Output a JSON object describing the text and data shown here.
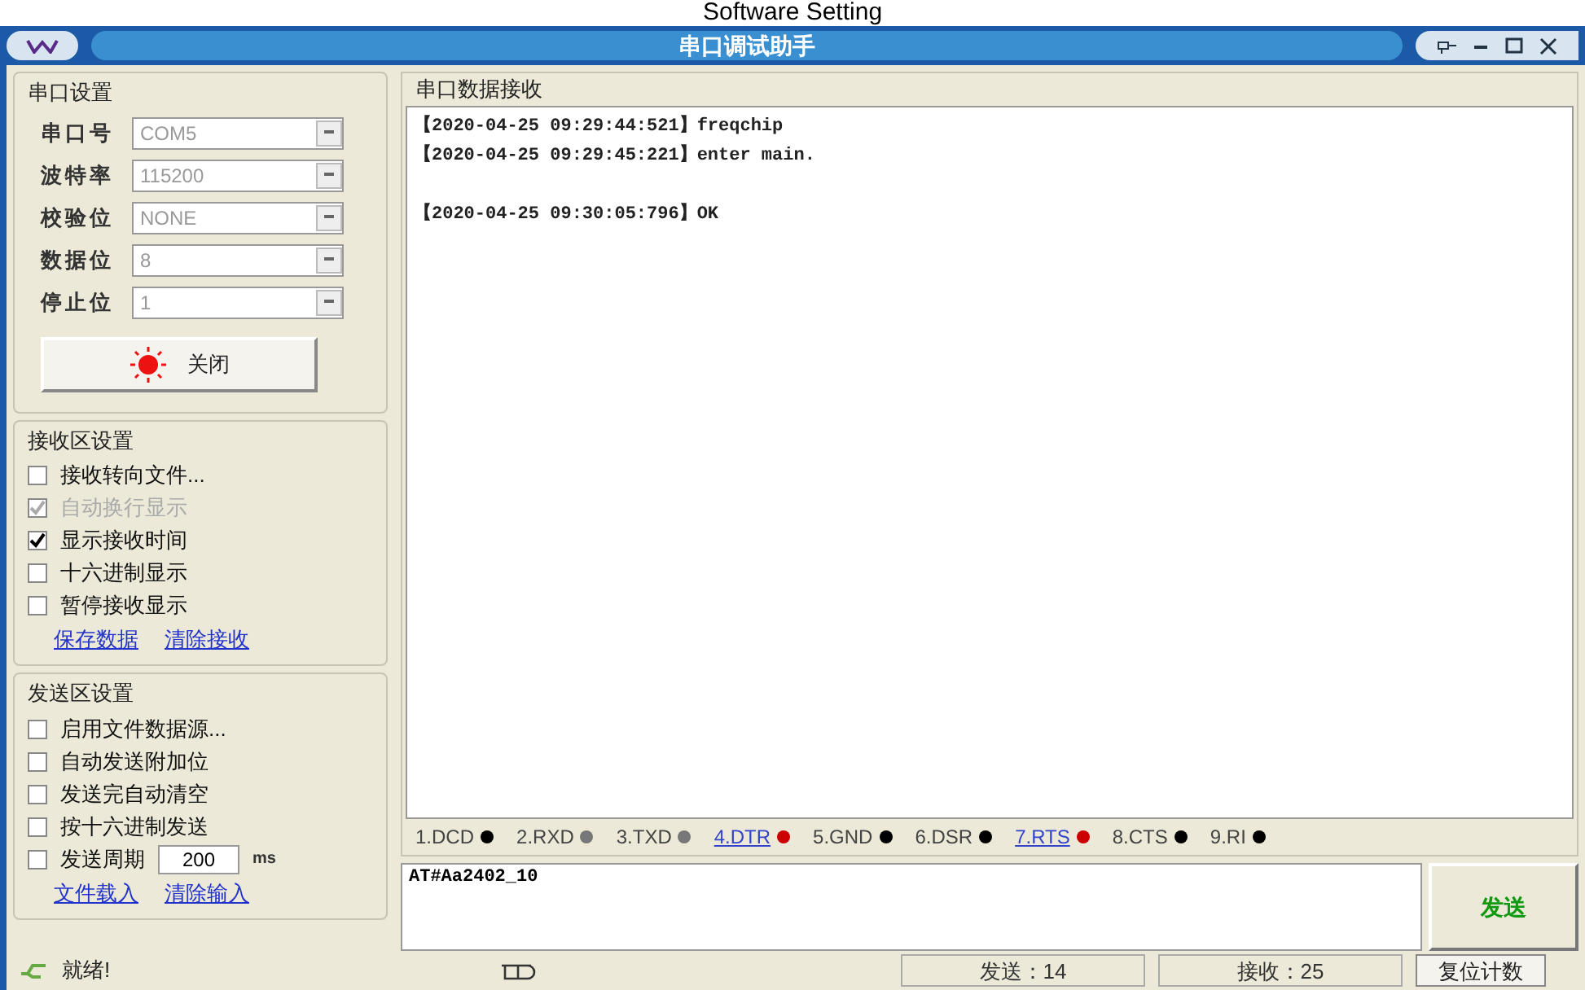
{
  "caption": "Software Setting",
  "window": {
    "title": "串口调试助手"
  },
  "serial_settings": {
    "title": "串口设置",
    "fields": [
      {
        "label": "串口号",
        "value": "COM5"
      },
      {
        "label": "波特率",
        "value": "115200"
      },
      {
        "label": "校验位",
        "value": "NONE"
      },
      {
        "label": "数据位",
        "value": "8"
      },
      {
        "label": "停止位",
        "value": "1"
      }
    ],
    "open_button": {
      "label": "关闭",
      "on": true
    }
  },
  "receive_settings": {
    "title": "接收区设置",
    "options": [
      {
        "label": "接收转向文件...",
        "checked": false
      },
      {
        "label": "自动换行显示",
        "checked": true,
        "disabled": true
      },
      {
        "label": "显示接收时间",
        "checked": true
      },
      {
        "label": "十六进制显示",
        "checked": false
      },
      {
        "label": "暂停接收显示",
        "checked": false
      }
    ],
    "links": [
      "保存数据",
      "清除接收"
    ]
  },
  "send_settings": {
    "title": "发送区设置",
    "options": [
      {
        "label": "启用文件数据源...",
        "checked": false
      },
      {
        "label": "自动发送附加位",
        "checked": false
      },
      {
        "label": "发送完自动清空",
        "checked": false
      },
      {
        "label": "按十六进制发送",
        "checked": false
      }
    ],
    "period": {
      "label": "发送周期",
      "checked": false,
      "value": "200",
      "unit": "ms"
    },
    "links": [
      "文件载入",
      "清除输入"
    ]
  },
  "receive_area": {
    "title": "串口数据接收",
    "blocks": [
      {
        "lines": [
          "【2020-04-25 09:29:44:521】freqchip",
          "【2020-04-25 09:29:45:221】enter main."
        ]
      },
      {
        "lines": [
          "【2020-04-25 09:30:05:796】OK"
        ]
      }
    ]
  },
  "pins": [
    {
      "label": "1.DCD",
      "link": false,
      "color": "#000000"
    },
    {
      "label": "2.RXD",
      "link": false,
      "color": "#777777"
    },
    {
      "label": "3.TXD",
      "link": false,
      "color": "#777777"
    },
    {
      "label": "4.DTR",
      "link": true,
      "color": "#cc0000"
    },
    {
      "label": "5.GND",
      "link": false,
      "color": "#000000"
    },
    {
      "label": "6.DSR",
      "link": false,
      "color": "#000000"
    },
    {
      "label": "7.RTS",
      "link": true,
      "color": "#cc0000"
    },
    {
      "label": "8.CTS",
      "link": false,
      "color": "#000000"
    },
    {
      "label": "9.RI",
      "link": false,
      "color": "#000000"
    }
  ],
  "send_input": {
    "value": "AT#Aa2402_10"
  },
  "send_button": "发送",
  "status_bar": {
    "status": "就绪!",
    "sent": "发送：14",
    "received": "接收：25",
    "reset_button": "复位计数"
  }
}
